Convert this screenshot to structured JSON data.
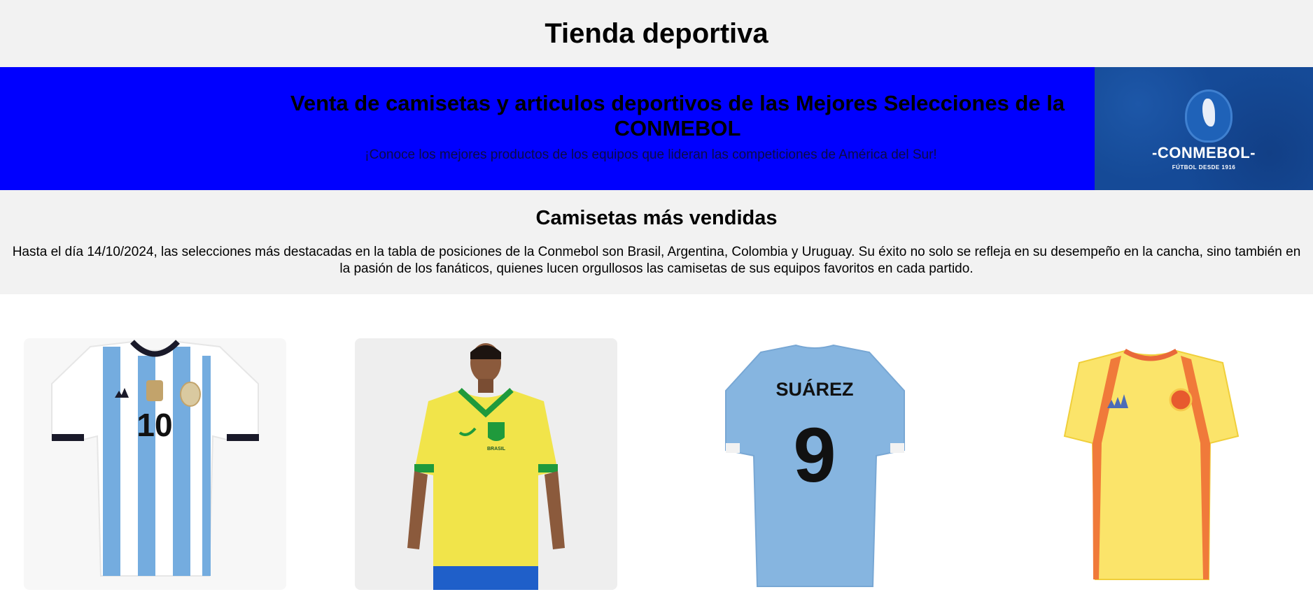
{
  "header": {
    "title": "Tienda deportiva"
  },
  "hero": {
    "heading": "Venta de camisetas y articulos deportivos de las Mejores Selecciones de la CONMEBOL",
    "tagline": "¡Conoce los mejores productos de los equipos que lideran las competiciones de América del Sur!",
    "logo": {
      "word": "-CONMEBOL-",
      "subtitle": "FÚTBOL DESDE 1916"
    },
    "colors": {
      "background": "#0000ff",
      "logo_background": "#154a97"
    }
  },
  "best_sellers": {
    "title": "Camisetas más vendidas",
    "paragraph": "Hasta el día 14/10/2024, las selecciones más destacadas en la tabla de posiciones de la Conmebol son Brasil, Argentina, Colombia y Uruguay. Su éxito no solo se refleja en su desempeño en la cancha, sino también en la pasión de los fanáticos, quienes lucen orgullosos las camisetas de sus equipos favoritos en cada partido."
  },
  "products": [
    {
      "name": "argentina-jersey",
      "number": "10",
      "icon": "argentina-jersey-image"
    },
    {
      "name": "brazil-jersey",
      "crest_text": "BRASIL",
      "icon": "brazil-jersey-image"
    },
    {
      "name": "uruguay-jersey",
      "player_name": "SUÁREZ",
      "number": "9",
      "icon": "uruguay-jersey-image"
    },
    {
      "name": "colombia-jersey",
      "icon": "colombia-jersey-image"
    }
  ]
}
